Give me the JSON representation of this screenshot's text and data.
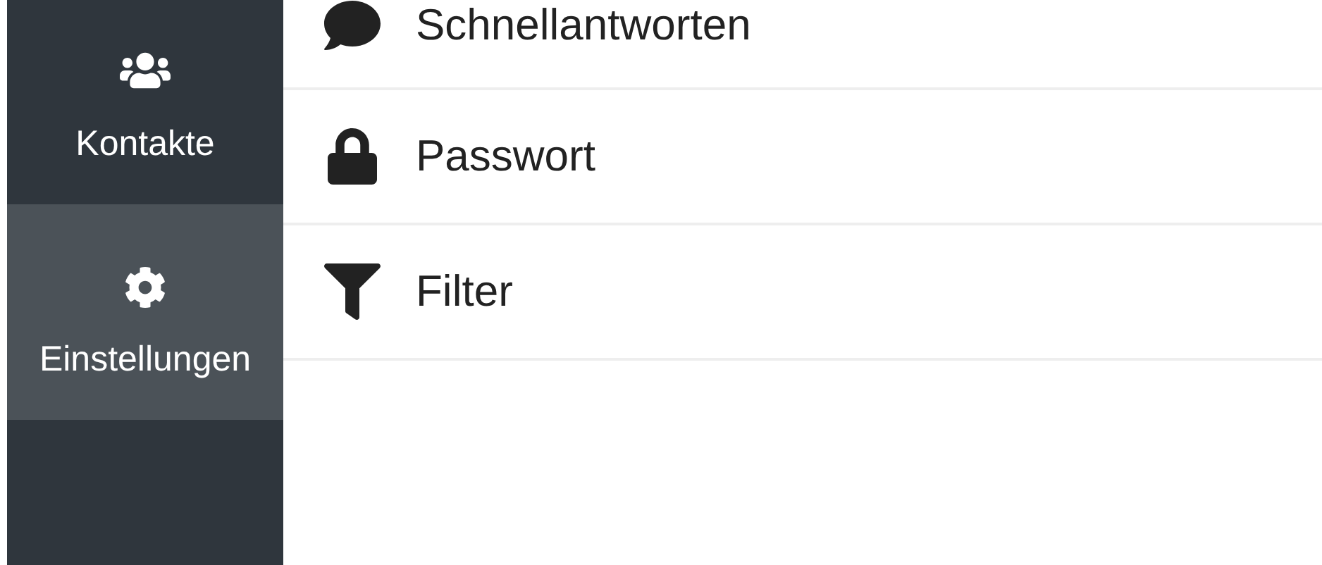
{
  "sidebar": {
    "items": [
      {
        "label": "Kontakte",
        "selected": false
      },
      {
        "label": "Einstellungen",
        "selected": true
      }
    ]
  },
  "settings_list": [
    {
      "label": "Schnellantworten"
    },
    {
      "label": "Passwort"
    },
    {
      "label": "Filter"
    }
  ]
}
